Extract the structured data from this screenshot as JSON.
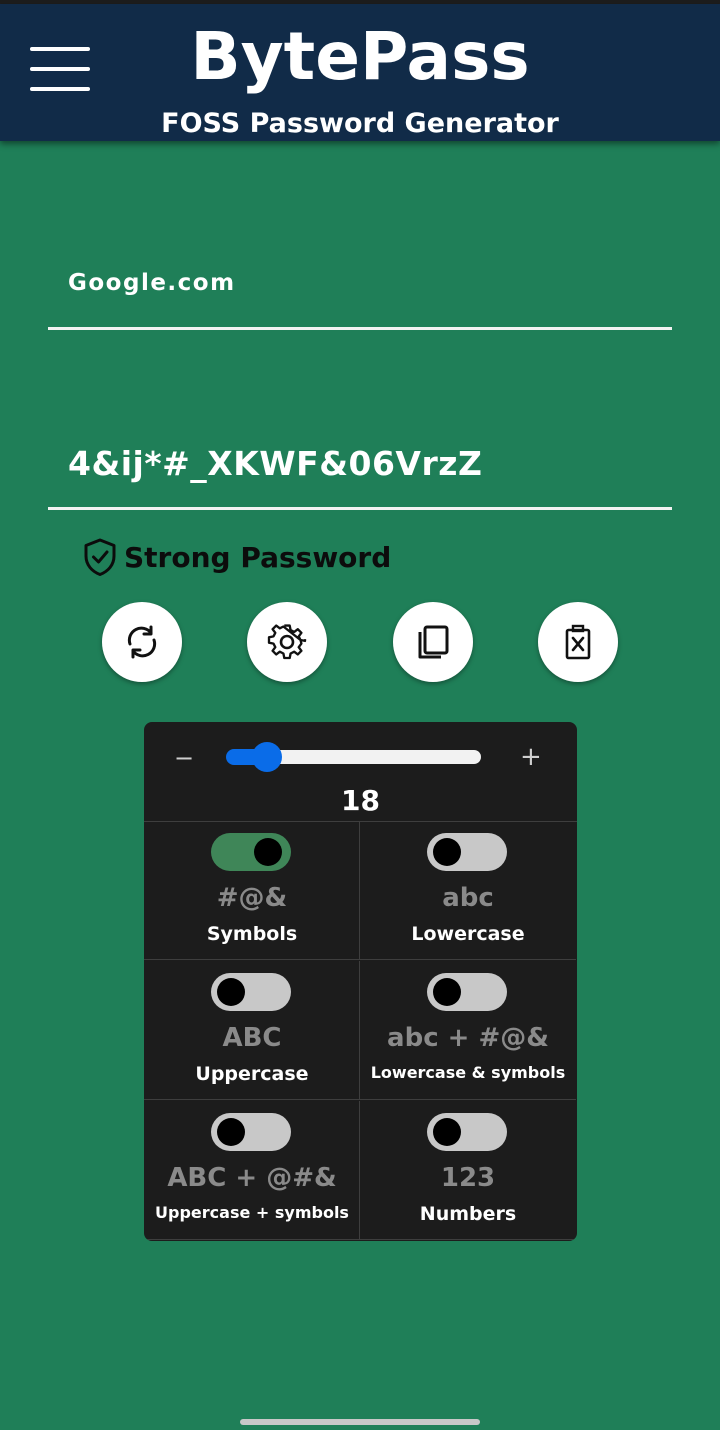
{
  "header": {
    "title": "BytePass",
    "subtitle": "FOSS Password Generator"
  },
  "inputs": {
    "site": "Google.com",
    "password": "4&ij*#_XKWF&06VrzZ"
  },
  "strength": {
    "label": "Strong Password"
  },
  "actions": [
    "refresh-icon",
    "gear-icon",
    "copy-icon",
    "clear-icon"
  ],
  "slider": {
    "minus": "−",
    "plus": "+",
    "value": "18",
    "fraction": 0.1
  },
  "options": [
    {
      "glyph": "#@&",
      "label": "Symbols",
      "on": true
    },
    {
      "glyph": "abc",
      "label": "Lowercase",
      "on": false
    },
    {
      "glyph": "ABC",
      "label": "Uppercase",
      "on": false
    },
    {
      "glyph": "abc + #@&",
      "label": "Lowercase & symbols",
      "on": false
    },
    {
      "glyph": "ABC + @#&",
      "label": "Uppercase + symbols",
      "on": false
    },
    {
      "glyph": "123",
      "label": "Numbers",
      "on": false
    }
  ],
  "colors": {
    "background": "#1f7f58",
    "header": "#112b48",
    "panel": "#1c1c1c",
    "slider_accent": "#0a6ce8",
    "toggle_on": "#3f8658"
  }
}
